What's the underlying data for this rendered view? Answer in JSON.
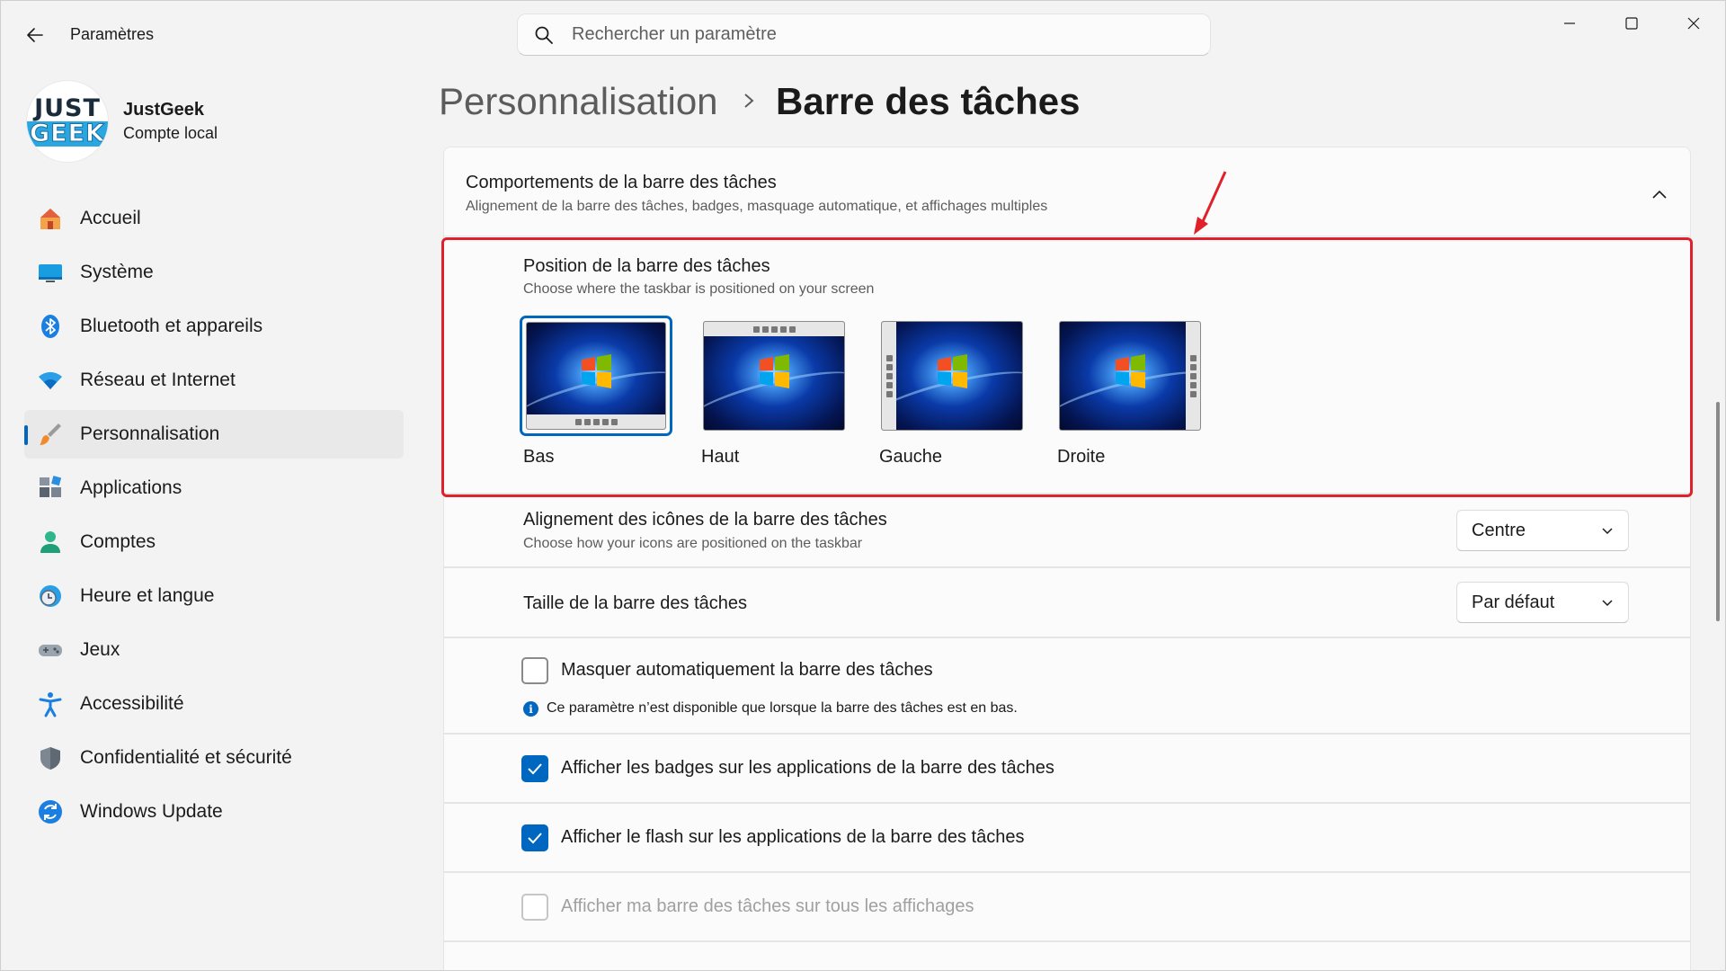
{
  "app": {
    "title": "Paramètres"
  },
  "search": {
    "placeholder": "Rechercher un paramètre"
  },
  "account": {
    "name": "JustGeek",
    "type": "Compte local",
    "logo_line1": "JUST",
    "logo_line2": "GEEK"
  },
  "nav": [
    {
      "label": "Accueil",
      "icon": "home-icon"
    },
    {
      "label": "Système",
      "icon": "monitor-icon"
    },
    {
      "label": "Bluetooth et appareils",
      "icon": "bluetooth-icon"
    },
    {
      "label": "Réseau et Internet",
      "icon": "wifi-icon"
    },
    {
      "label": "Personnalisation",
      "icon": "paintbrush-icon",
      "active": true
    },
    {
      "label": "Applications",
      "icon": "apps-icon"
    },
    {
      "label": "Comptes",
      "icon": "person-icon"
    },
    {
      "label": "Heure et langue",
      "icon": "clock-globe-icon"
    },
    {
      "label": "Jeux",
      "icon": "gamepad-icon"
    },
    {
      "label": "Accessibilité",
      "icon": "accessibility-icon"
    },
    {
      "label": "Confidentialité et sécurité",
      "icon": "shield-icon"
    },
    {
      "label": "Windows Update",
      "icon": "update-icon"
    }
  ],
  "breadcrumb": {
    "parent": "Personnalisation",
    "current": "Barre des tâches"
  },
  "behaviors": {
    "title": "Comportements de la barre des tâches",
    "subtitle": "Alignement de la barre des tâches, badges, masquage automatique, et affichages multiples"
  },
  "position": {
    "title": "Position de la barre des tâches",
    "subtitle": "Choose where the taskbar is positioned on your screen",
    "options": [
      {
        "label": "Bas",
        "selected": true
      },
      {
        "label": "Haut",
        "selected": false
      },
      {
        "label": "Gauche",
        "selected": false
      },
      {
        "label": "Droite",
        "selected": false
      }
    ]
  },
  "alignment": {
    "title": "Alignement des icônes de la barre des tâches",
    "subtitle": "Choose how your icons are positioned on the taskbar",
    "value": "Centre"
  },
  "size": {
    "title": "Taille de la barre des tâches",
    "value": "Par défaut"
  },
  "options": {
    "autohide": {
      "label": "Masquer automatiquement la barre des tâches",
      "checked": false
    },
    "autohide_info": "Ce paramètre n’est disponible que lorsque la barre des tâches est en bas.",
    "badges": {
      "label": "Afficher les badges sur les applications de la barre des tâches",
      "checked": true
    },
    "flash": {
      "label": "Afficher le flash sur les applications de la barre des tâches",
      "checked": true
    },
    "all_displays": {
      "label": "Afficher ma barre des tâches sur tous les affichages",
      "checked": false,
      "disabled": true
    }
  },
  "colors": {
    "accent": "#0067c0",
    "highlight": "#e0202a"
  }
}
